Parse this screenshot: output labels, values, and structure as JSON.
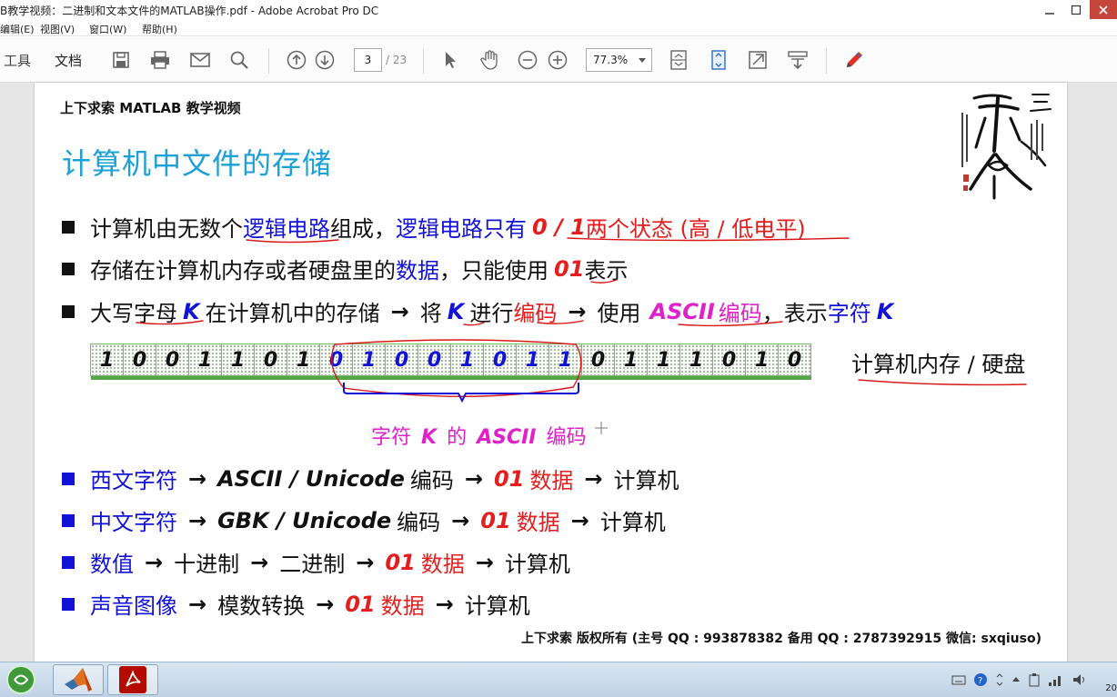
{
  "window": {
    "title": "B教学视频：二进制和文本文件的MATLAB操作.pdf - Adobe Acrobat Pro DC"
  },
  "menu": {
    "items": [
      "编辑(E)",
      "视图(V)",
      "窗口(W)",
      "帮助(H)"
    ]
  },
  "toolbar": {
    "tab_tools": "工具",
    "tab_document": "文档",
    "page_current": "3",
    "page_total": "/ 23",
    "zoom": "77.3%"
  },
  "slide": {
    "header": "上下求索 MATLAB 教学视频",
    "title": "计算机中文件的存储",
    "bullet1": {
      "t1": "计算机由无数个",
      "t2": "逻辑电路",
      "t3": "组成，",
      "t4": "逻辑电路只有",
      "t5": "0 / 1",
      "t6": " 两个状态 (高 / 低电平)"
    },
    "bullet2": {
      "t1": "存储在计算机内存或者硬盘里的",
      "t2": "数据",
      "t3": "，只能使用",
      "t4": "01",
      "t5": " 表示"
    },
    "bullet3": {
      "t1": "大写",
      "t2": "字母",
      "t3": "K",
      "t4": "在计算机中的存储",
      "arrow": "→",
      "t5": "将",
      "t6": "K",
      "t7": "进行",
      "t8": "编码",
      "t9": "使用",
      "t10": "ASCII",
      "t11": "编码",
      "t12": "，表示",
      "t13": "字符",
      "t14": "K"
    },
    "bits": [
      "1",
      "0",
      "0",
      "1",
      "1",
      "0",
      "1",
      "0",
      "1",
      "0",
      "0",
      "1",
      "0",
      "1",
      "1",
      "0",
      "1",
      "1",
      "1",
      "0",
      "1",
      "0"
    ],
    "bits_label": "计算机内存 / 硬盘",
    "brace_label_a": "字符",
    "brace_label_k": "K",
    "brace_label_b": "的",
    "brace_label_ascii": "ASCII",
    "brace_label_c": "编码",
    "items": [
      {
        "head": "西文字符",
        "mid1": "ASCII / Unicode",
        "mid2": "编码",
        "data01": "01",
        "data": "数据",
        "tail": "计算机"
      },
      {
        "head": "中文字符",
        "mid1": "GBK / Unicode",
        "mid2": "编码",
        "data01": "01",
        "data": "数据",
        "tail": "计算机"
      },
      {
        "head": "数值",
        "mid1": "十进制",
        "mid2": "二进制",
        "data01": "01",
        "data": "数据",
        "tail": "计算机"
      },
      {
        "head": "声音图像",
        "mid1": "模数转换",
        "data01": "01",
        "data": "数据",
        "tail": "计算机"
      }
    ],
    "arrow": "→",
    "footer": "上下求索  版权所有  (主号 QQ : 993878382   备用 QQ : 2787392915   微信: sxqiuso)"
  },
  "taskbar": {
    "time_partial": "20"
  },
  "colors": {
    "title_blue": "#1ba0d8",
    "text_blue": "#1212d6",
    "text_red": "#e41e1e",
    "text_magenta": "#e020c8",
    "bit_border_green": "#54a646",
    "annotation_red": "#d81818"
  }
}
